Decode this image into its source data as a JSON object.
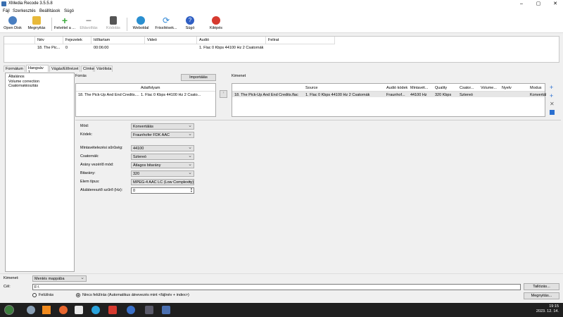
{
  "window": {
    "title": "XMedia Recode 3.5.5.8",
    "minimize": "–",
    "maximize": "▢",
    "close": "✕"
  },
  "menu": [
    "Fájl",
    "Szerkesztés",
    "Beállítások",
    "Súgó"
  ],
  "toolbar": [
    {
      "label": "Open Disk",
      "icon": "disc-icon",
      "color": "#4a7fc1",
      "enabled": true
    },
    {
      "label": "Megnyitás",
      "icon": "folder-open-icon",
      "color": "#e8b93a",
      "enabled": true
    },
    {
      "label": "Felvétel a ...",
      "icon": "add-icon",
      "color": "#3fae3f",
      "enabled": true
    },
    {
      "label": "Eltávolítás",
      "icon": "remove-icon",
      "color": "#9a9a9a",
      "enabled": false
    },
    {
      "label": "Kódolás",
      "icon": "encode-icon",
      "color": "#9a9a9a",
      "enabled": false
    },
    {
      "label": "Weboldal",
      "icon": "globe-icon",
      "color": "#2a8fd0",
      "enabled": true
    },
    {
      "label": "Frissítések...",
      "icon": "refresh-icon",
      "color": "#2d86d6",
      "enabled": true
    },
    {
      "label": "Súgó",
      "icon": "help-icon",
      "color": "#2f5fc4",
      "enabled": true
    },
    {
      "label": "Kilépés",
      "icon": "exit-icon",
      "color": "#d63a2f",
      "enabled": true
    }
  ],
  "filelist": {
    "headers": [
      "Név",
      "Fejezetek",
      "Időtartam",
      "Videó",
      "Audió",
      "Felirat"
    ],
    "row": [
      "18. The Pic...",
      "0",
      "00:06:00",
      "",
      "1. Flac 0 Kbps 44100 Hz 2 Csatornák",
      ""
    ]
  },
  "tabs": [
    "Formátum",
    "Hangsáv 1",
    "Vágás/Előnézet",
    "Címke",
    "Várólista"
  ],
  "active_tab": "Hangsáv 1",
  "left_items": [
    "Általános",
    "Volume correction",
    "Csatornakiosztás"
  ],
  "source": {
    "label": "Forrás",
    "import_button": "Importálás",
    "col_header": "Adatfolyam",
    "row_name": "18. The Pick-Up And End Credits....",
    "row_stream": "1. Flac 0 Kbps 44100 Hz 2 Csato..."
  },
  "output": {
    "label": "Kimenet",
    "headers": [
      "",
      "Source",
      "Audió kódek",
      "Mintavét...",
      "Quality",
      "Csator...",
      "Volume...",
      "Nyelv",
      "Modus"
    ],
    "row": [
      "18. The Pick-Up And End Credits.flac",
      "1. Flac 0 Kbps 44100 Hz 2 Csatornák",
      "Fraunhof...",
      "44100 Hz",
      "320 Kbps",
      "Sztereó",
      "",
      "",
      "Konvertál"
    ]
  },
  "settings": [
    {
      "label": "Mód:",
      "value": "Konvertálás"
    },
    {
      "label": "Kódek:",
      "value": "Fraunhofer FDK AAC"
    },
    {
      "label": "Mintavételezési sűrűség:",
      "value": "44100"
    },
    {
      "label": "Csatornák:",
      "value": "Sztereó"
    },
    {
      "label": "Arány vezérlő mód:",
      "value": "Átlagos bitarány"
    },
    {
      "label": "Bitarány:",
      "value": "320"
    },
    {
      "label": "Elem típus:",
      "value": "MPEG-4 AAC LC (Low Complexity)"
    },
    {
      "label": "Aluláteresztő szűrő (Hz):",
      "value": "0"
    }
  ],
  "bottom": {
    "output_label": "Kimenet:",
    "output_value": "Mentés mappába",
    "target_label": "Cél:",
    "target_value": "F:\\",
    "browse_button": "Tallózás...",
    "open_button": "Megnyitás...",
    "radio1": "Felülírás",
    "radio2": "Nincs felülírás (Automatikus átnevezés mint <fájlnév + index>)"
  },
  "taskbar": {
    "time": "19:15",
    "date": "2023. 12. 14."
  }
}
